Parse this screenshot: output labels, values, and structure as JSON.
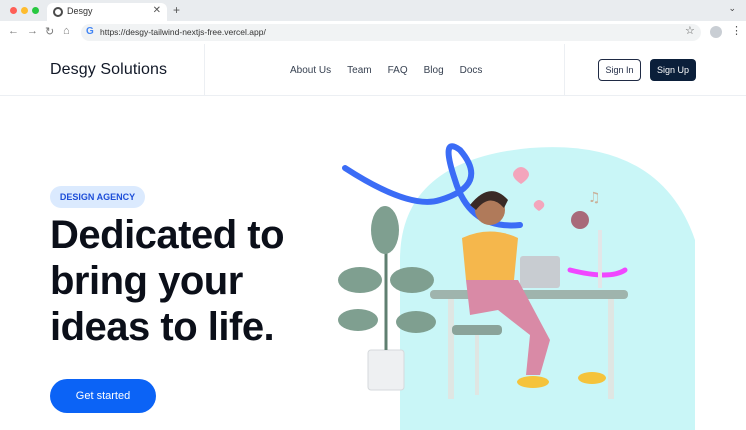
{
  "browser": {
    "tab_title": "Desgy",
    "url": "https://desgy-tailwind-nextjs-free.vercel.app/",
    "icons": [
      "back-icon",
      "forward-icon",
      "reload-icon",
      "home-icon",
      "star-icon",
      "menu-icon"
    ]
  },
  "navbar": {
    "brand": "Desgy Solutions",
    "links": [
      "About Us",
      "Team",
      "FAQ",
      "Blog",
      "Docs"
    ],
    "sign_in": "Sign In",
    "sign_up": "Sign Up"
  },
  "hero": {
    "badge": "DESIGN AGENCY",
    "headline": [
      "Dedicated to",
      "bring your",
      "ideas to life."
    ],
    "cta": "Get started"
  },
  "colors": {
    "accent": "#0b63f6",
    "badge_bg": "#dbeafe",
    "badge_text": "#1d4ed8",
    "signup_bg": "#0b1f3a",
    "illustration_bg": "#c9f6f7"
  }
}
